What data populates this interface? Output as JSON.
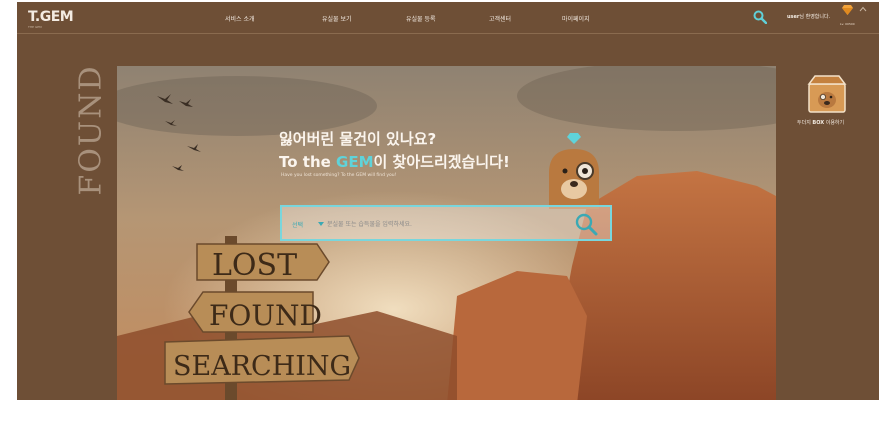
{
  "header": {
    "logo_main": "T.GEM",
    "logo_sub": "THE GEM",
    "nav": [
      "서비스 소개",
      "유실물 보기",
      "유실물 등록",
      "고객센터",
      "마이페이지"
    ],
    "greeting_user": "user",
    "greeting_rest": "님 환영합니다.",
    "level": "Lv. 00500"
  },
  "side_title": "FOUND",
  "hero": {
    "title_line1": "잃어버린 물건이 있나요?",
    "title_line2_prefix": "To the ",
    "title_line2_gem": "GEM",
    "title_line2_suffix": "이 찾아드리겠습니다!",
    "subtitle": "Have you lost something? To the GEM will find you!",
    "signs": [
      "LOST",
      "FOUND",
      "SEARCHING"
    ]
  },
  "search": {
    "select_label": "선택",
    "placeholder": "분실물 또는 습득물을 입력하세요."
  },
  "widget": {
    "label_pre": "두더지 ",
    "label_bold": "BOX",
    "label_post": " 이용하기"
  },
  "colors": {
    "page_bg": "#6e4f36",
    "accent": "#5fd0d8",
    "text_light": "#f3ebe2"
  },
  "icons": {
    "search": "search-icon",
    "gem": "gem-icon",
    "chevron": "chevron-up-icon",
    "box": "box-icon"
  }
}
